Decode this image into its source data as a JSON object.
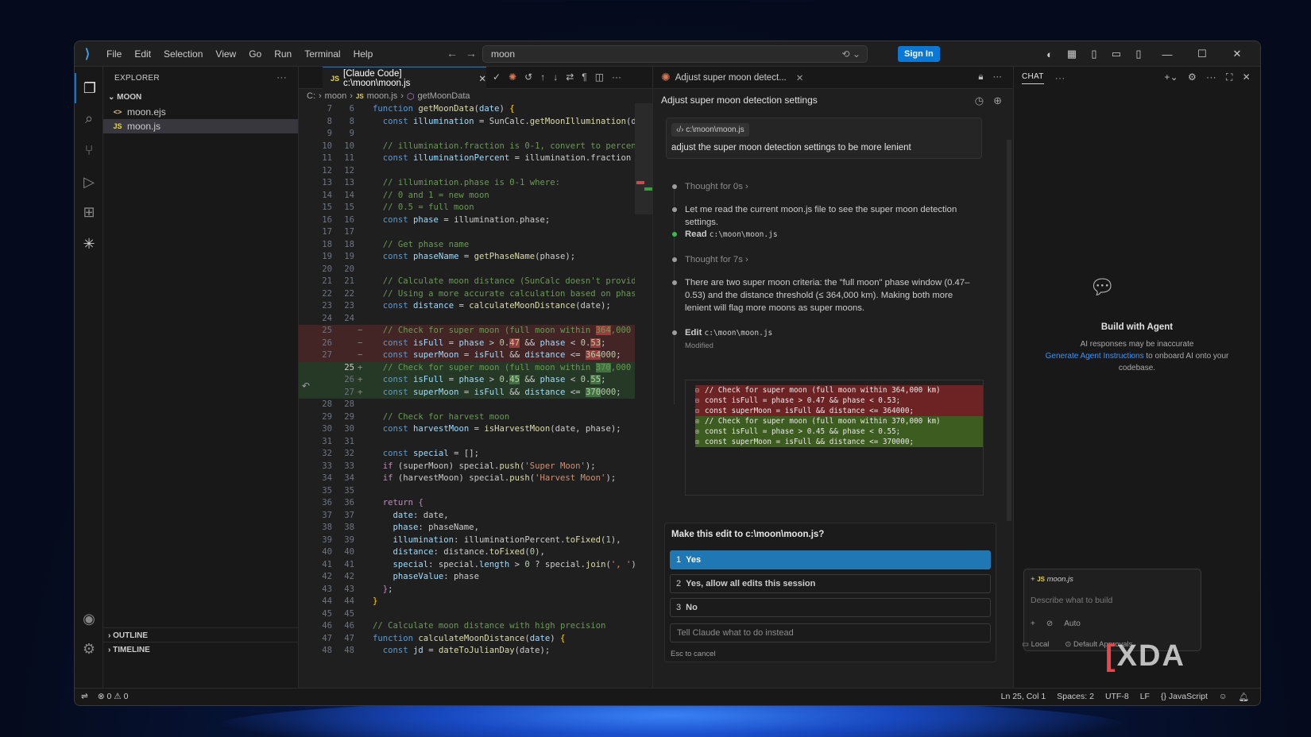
{
  "menu": [
    "File",
    "Edit",
    "Selection",
    "View",
    "Go",
    "Run",
    "Terminal",
    "Help"
  ],
  "search": {
    "value": "moon"
  },
  "titlebar": {
    "signin": "Sign In"
  },
  "explorer": {
    "title": "EXPLORER",
    "folder": "MOON",
    "files": [
      {
        "name": "moon.ejs",
        "icon": "<>"
      },
      {
        "name": "moon.js",
        "icon": "JS"
      }
    ],
    "outline": "OUTLINE",
    "timeline": "TIMELINE"
  },
  "editor": {
    "tab_label": "[Claude Code] c:\\moon\\moon.js",
    "breadcrumbs": [
      "C:",
      "moon",
      "moon.js",
      "getMoonData"
    ],
    "lines": [
      {
        "n1": "7",
        "n2": "6",
        "k": "",
        "h": "<span class='kb'>function</span> <span class='f'>getMoonData</span>(<span class='v'>date</span>) <span class='br'>{</span>"
      },
      {
        "n1": "8",
        "n2": "8",
        "k": "",
        "h": "  <span class='kb'>const</span> <span class='v'>illumination</span> = SunCalc.<span class='f'>getMoonIllumination</span>(d"
      },
      {
        "n1": "9",
        "n2": "9",
        "k": "",
        "h": ""
      },
      {
        "n1": "10",
        "n2": "10",
        "k": "",
        "h": "  <span class='c'>// illumination.fraction is 0-1, convert to percen</span>"
      },
      {
        "n1": "11",
        "n2": "11",
        "k": "",
        "h": "  <span class='kb'>const</span> <span class='v'>illuminationPercent</span> = illumination.fraction"
      },
      {
        "n1": "12",
        "n2": "12",
        "k": "",
        "h": ""
      },
      {
        "n1": "13",
        "n2": "13",
        "k": "",
        "h": "  <span class='c'>// illumination.phase is 0-1 where:</span>"
      },
      {
        "n1": "14",
        "n2": "14",
        "k": "",
        "h": "  <span class='c'>// 0 and 1 = new moon</span>"
      },
      {
        "n1": "15",
        "n2": "15",
        "k": "",
        "h": "  <span class='c'>// 0.5 = full moon</span>"
      },
      {
        "n1": "16",
        "n2": "16",
        "k": "",
        "h": "  <span class='kb'>const</span> <span class='v'>phase</span> = illumination.phase;"
      },
      {
        "n1": "17",
        "n2": "17",
        "k": "",
        "h": ""
      },
      {
        "n1": "18",
        "n2": "18",
        "k": "",
        "h": "  <span class='c'>// Get phase name</span>"
      },
      {
        "n1": "19",
        "n2": "19",
        "k": "",
        "h": "  <span class='kb'>const</span> <span class='v'>phaseName</span> = <span class='f'>getPhaseName</span>(phase);"
      },
      {
        "n1": "20",
        "n2": "20",
        "k": "",
        "h": ""
      },
      {
        "n1": "21",
        "n2": "21",
        "k": "",
        "h": "  <span class='c'>// Calculate moon distance (SunCalc doesn't provid</span>"
      },
      {
        "n1": "22",
        "n2": "22",
        "k": "",
        "h": "  <span class='c'>// Using a more accurate calculation based on phas</span>"
      },
      {
        "n1": "23",
        "n2": "23",
        "k": "",
        "h": "  <span class='kb'>const</span> <span class='v'>distance</span> = <span class='f'>calculateMoonDistance</span>(date);"
      },
      {
        "n1": "24",
        "n2": "24",
        "k": "",
        "h": ""
      },
      {
        "n1": "25",
        "n2": "",
        "k": "del",
        "h": "  <span class='c'>// Check for super moon (full moon within <span class='hl-del'>364</span>,000</span>"
      },
      {
        "n1": "26",
        "n2": "",
        "k": "del",
        "h": "  <span class='kb'>const</span> <span class='v'>isFull</span> = <span class='v'>phase</span> &gt; <span class='num'>0.<span class='hl-del'>47</span></span> &amp;&amp; <span class='v'>phase</span> &lt; <span class='num'>0.<span class='hl-del'>53</span></span>;"
      },
      {
        "n1": "27",
        "n2": "",
        "k": "del",
        "h": "  <span class='kb'>const</span> <span class='v'>superMoon</span> = <span class='v'>isFull</span> &amp;&amp; <span class='v'>distance</span> &lt;= <span class='num'><span class='hl-del'>364</span>000</span>;"
      },
      {
        "n1": "",
        "n2": "25",
        "k": "ins cur",
        "h": "  <span class='c'>// Check for super moon (full moon within <span class='hl-ins'>370</span>,000</span>"
      },
      {
        "n1": "",
        "n2": "26",
        "k": "ins",
        "h": "  <span class='kb'>const</span> <span class='v'>isFull</span> = <span class='v'>phase</span> &gt; <span class='num'>0.<span class='hl-ins'>45</span></span> &amp;&amp; <span class='v'>phase</span> &lt; <span class='num'>0.<span class='hl-ins'>55</span></span>;"
      },
      {
        "n1": "",
        "n2": "27",
        "k": "ins",
        "h": "  <span class='kb'>const</span> <span class='v'>superMoon</span> = <span class='v'>isFull</span> &amp;&amp; <span class='v'>distance</span> &lt;= <span class='num'><span class='hl-ins'>370</span>000</span>;"
      },
      {
        "n1": "28",
        "n2": "28",
        "k": "",
        "h": ""
      },
      {
        "n1": "29",
        "n2": "29",
        "k": "",
        "h": "  <span class='c'>// Check for harvest moon</span>"
      },
      {
        "n1": "30",
        "n2": "30",
        "k": "",
        "h": "  <span class='kb'>const</span> <span class='v'>harvestMoon</span> = <span class='f'>isHarvestMoon</span>(date, phase);"
      },
      {
        "n1": "31",
        "n2": "31",
        "k": "",
        "h": ""
      },
      {
        "n1": "32",
        "n2": "32",
        "k": "",
        "h": "  <span class='kb'>const</span> <span class='v'>special</span> = [];"
      },
      {
        "n1": "33",
        "n2": "33",
        "k": "",
        "h": "  <span class='k'>if</span> (superMoon) special.<span class='f'>push</span>(<span class='s'>'Super Moon'</span>);"
      },
      {
        "n1": "34",
        "n2": "34",
        "k": "",
        "h": "  <span class='k'>if</span> (harvestMoon) special.<span class='f'>push</span>(<span class='s'>'Harvest Moon'</span>);"
      },
      {
        "n1": "35",
        "n2": "35",
        "k": "",
        "h": ""
      },
      {
        "n1": "36",
        "n2": "36",
        "k": "",
        "h": "  <span class='k'>return</span> <span class='k'>{</span>"
      },
      {
        "n1": "37",
        "n2": "37",
        "k": "",
        "h": "    <span class='v'>date</span>: date,"
      },
      {
        "n1": "38",
        "n2": "38",
        "k": "",
        "h": "    <span class='v'>phase</span>: phaseName,"
      },
      {
        "n1": "39",
        "n2": "39",
        "k": "",
        "h": "    <span class='v'>illumination</span>: illuminationPercent.<span class='f'>toFixed</span>(<span class='num'>1</span>),"
      },
      {
        "n1": "40",
        "n2": "40",
        "k": "",
        "h": "    <span class='v'>distance</span>: distance.<span class='f'>toFixed</span>(<span class='num'>0</span>),"
      },
      {
        "n1": "41",
        "n2": "41",
        "k": "",
        "h": "    <span class='v'>special</span>: special.<span class='v'>length</span> &gt; <span class='num'>0</span> ? special.<span class='f'>join</span>(<span class='s'>', '</span>)"
      },
      {
        "n1": "42",
        "n2": "42",
        "k": "",
        "h": "    <span class='v'>phaseValue</span>: phase"
      },
      {
        "n1": "43",
        "n2": "43",
        "k": "",
        "h": "  <span class='k'>}</span>;"
      },
      {
        "n1": "44",
        "n2": "44",
        "k": "",
        "h": "<span class='br'>}</span>"
      },
      {
        "n1": "45",
        "n2": "45",
        "k": "",
        "h": ""
      },
      {
        "n1": "46",
        "n2": "46",
        "k": "",
        "h": "<span class='c'>// Calculate moon distance with high precision</span>"
      },
      {
        "n1": "47",
        "n2": "47",
        "k": "",
        "h": "<span class='kb'>function</span> <span class='f'>calculateMoonDistance</span>(<span class='v'>date</span>) <span class='br'>{</span>"
      },
      {
        "n1": "48",
        "n2": "48",
        "k": "",
        "h": "  <span class='kb'>const</span> <span class='v'>jd</span> = <span class='f'>dateToJulianDay</span>(date);"
      }
    ]
  },
  "claude": {
    "tab_label": "Adjust super moon detect...",
    "title": "Adjust super moon detection settings",
    "prompt_file": "c:\\moon\\moon.js",
    "prompt_text": "adjust the super moon detection settings to be more lenient",
    "thought1": "Thought for 0s",
    "msg1": "Let me read the current moon.js file to see the super moon detection settings.",
    "read_label": "Read",
    "read_path": "c:\\moon\\moon.js",
    "thought2": "Thought for 7s",
    "msg2": "There are two super moon criteria: the \"full moon\" phase window (0.47–0.53) and the distance threshold (≤ 364,000 km). Making both more lenient will flag more moons as super moons.",
    "edit_label": "Edit",
    "edit_path": "c:\\moon\\moon.js",
    "modified": "Modified",
    "diff": [
      {
        "t": "del",
        "g": "⊟",
        "s": "// Check for super moon (full moon within 364,000 km)"
      },
      {
        "t": "del",
        "g": "⊟",
        "s": "const isFull = phase > 0.47 && phase < 0.53;"
      },
      {
        "t": "del",
        "g": "⊟",
        "s": "const superMoon = isFull && distance <= 364000;"
      },
      {
        "t": "ins",
        "g": "⊞",
        "s": "// Check for super moon (full moon within 370,000 km)"
      },
      {
        "t": "ins",
        "g": "⊞",
        "s": "const isFull = phase > 0.45 && phase < 0.55;"
      },
      {
        "t": "ins",
        "g": "⊞",
        "s": "const superMoon = isFull && distance <= 370000;"
      }
    ],
    "question": "Make this edit to c:\\moon\\moon.js?",
    "options": [
      {
        "num": "1",
        "label": "Yes"
      },
      {
        "num": "2",
        "label": "Yes, allow all edits this session"
      },
      {
        "num": "3",
        "label": "No"
      }
    ],
    "tell_placeholder": "Tell Claude what to do instead",
    "esc": "Esc to cancel"
  },
  "chat": {
    "title": "CHAT",
    "build_title": "Build with Agent",
    "build_text1": "AI responses may be inaccurate",
    "build_link": "Generate Agent Instructions",
    "build_text2": "to onboard AI onto your codebase.",
    "input_file": "moon.js",
    "input_placeholder": "Describe what to build",
    "mode": "Auto",
    "local": "Local",
    "approvals": "Default Approvals"
  },
  "status": {
    "errors": "0",
    "warnings": "0",
    "position": "Ln 25, Col 1",
    "spaces": "Spaces: 2",
    "encoding": "UTF-8",
    "eol": "LF",
    "language": "JavaScript"
  },
  "watermark": "XDA"
}
